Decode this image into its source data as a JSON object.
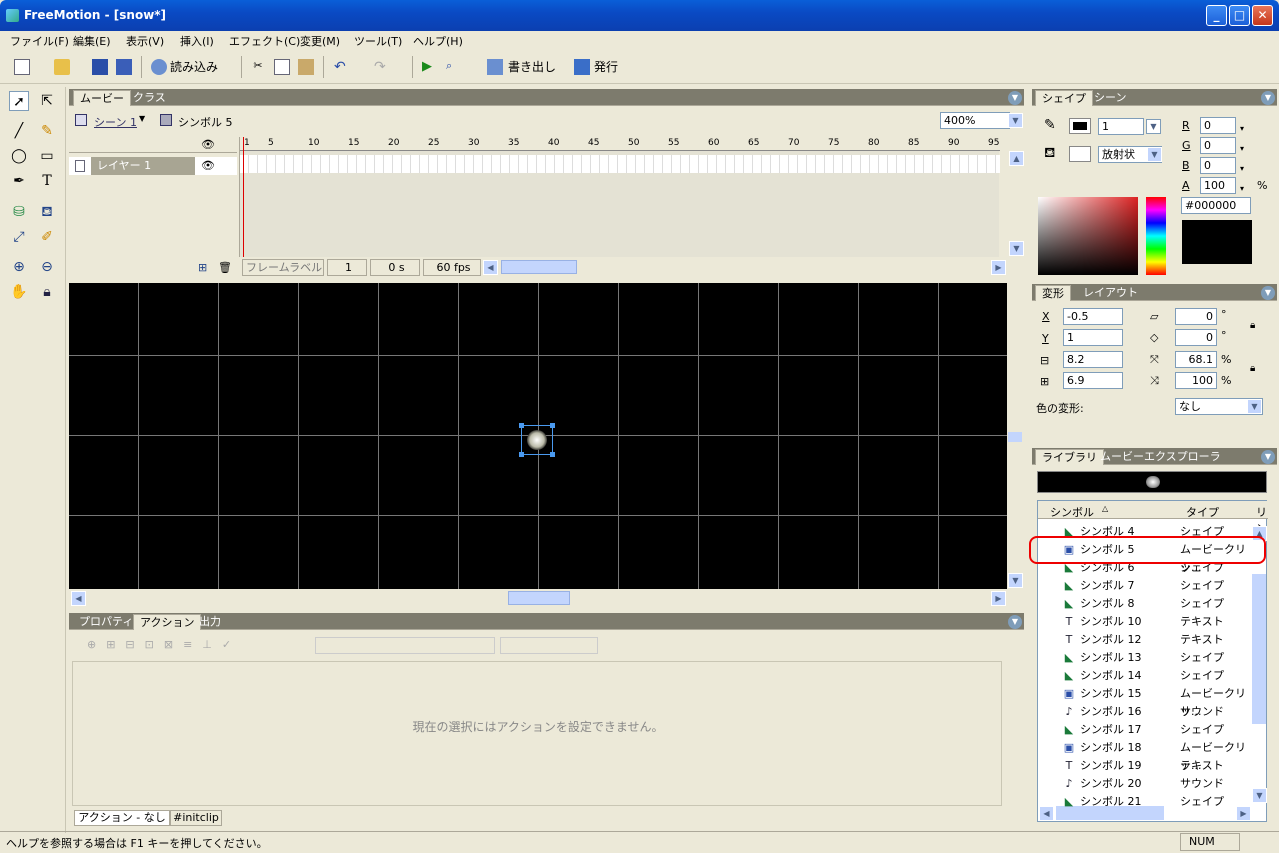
{
  "window": {
    "title": "FreeMotion - [snow*]"
  },
  "menu": [
    "ファイル(F)",
    "編集(E)",
    "表示(V)",
    "挿入(I)",
    "エフェクト(C)",
    "変更(M)",
    "ツール(T)",
    "ヘルプ(H)"
  ],
  "toolbar": {
    "import_label": "読み込み",
    "export_label": "書き出し",
    "publish_label": "発行"
  },
  "timeline": {
    "tabs": [
      "ムービー",
      "クラス"
    ],
    "scene": "シーン 1",
    "symbol": "シンボル 5",
    "zoom": "400%",
    "ruler": [
      "1",
      "5",
      "10",
      "15",
      "20",
      "25",
      "30",
      "35",
      "40",
      "45",
      "50",
      "55",
      "60",
      "65",
      "70",
      "75",
      "80",
      "85",
      "90",
      "95"
    ],
    "layer": "レイヤー 1",
    "frame_label": "フレームラベル",
    "frame": "1",
    "time": "0 s",
    "fps": "60 fps"
  },
  "bottom_panel": {
    "tabs": [
      "プロパティ",
      "アクション",
      "出力"
    ],
    "message": "現在の選択にはアクションを設定できません。",
    "subtabs": [
      "アクション - なし",
      "#initclip"
    ]
  },
  "shape_panel": {
    "tabs": [
      "シェイプ",
      "シーン"
    ],
    "stroke_width": "1",
    "fill_type": "放射状",
    "r_label": "R",
    "r": "0",
    "g_label": "G",
    "g": "0",
    "b_label": "B",
    "b": "0",
    "a_label": "A",
    "a": "100",
    "pct": "%",
    "hex": "#000000"
  },
  "transform_panel": {
    "tabs": [
      "変形",
      "レイアウト"
    ],
    "x_label": "X",
    "x": "-0.5",
    "y_label": "Y",
    "y": "1",
    "w": "8.2",
    "h": "6.9",
    "skew1": "0",
    "skew2": "0",
    "deg": "°",
    "scale_x": "68.1",
    "scale_y": "100",
    "pct": "%",
    "color_label": "色の変形:",
    "color_value": "なし"
  },
  "library": {
    "tabs": [
      "ライブラリ",
      "ムービーエクスプローラ"
    ],
    "col_symbol": "シンボル",
    "col_type": "タイプ",
    "col_link": "リン",
    "rows": [
      {
        "name": "シンボル 4",
        "type": "シェイプ",
        "icon": "shape"
      },
      {
        "name": "シンボル 5",
        "type": "ムービークリッ...",
        "icon": "movieclip"
      },
      {
        "name": "シンボル 6",
        "type": "シェイプ",
        "icon": "shape"
      },
      {
        "name": "シンボル 7",
        "type": "シェイプ",
        "icon": "shape"
      },
      {
        "name": "シンボル 8",
        "type": "シェイプ",
        "icon": "shape"
      },
      {
        "name": "シンボル 10",
        "type": "テキスト",
        "icon": "text"
      },
      {
        "name": "シンボル 12",
        "type": "テキスト",
        "icon": "text"
      },
      {
        "name": "シンボル 13",
        "type": "シェイプ",
        "icon": "shape"
      },
      {
        "name": "シンボル 14",
        "type": "シェイプ",
        "icon": "shape"
      },
      {
        "name": "シンボル 15",
        "type": "ムービークリッ...",
        "icon": "movieclip"
      },
      {
        "name": "シンボル 16",
        "type": "サウンド",
        "icon": "sound"
      },
      {
        "name": "シンボル 17",
        "type": "シェイプ",
        "icon": "shape"
      },
      {
        "name": "シンボル 18",
        "type": "ムービークリッ...",
        "icon": "movieclip"
      },
      {
        "name": "シンボル 19",
        "type": "テキスト",
        "icon": "text"
      },
      {
        "name": "シンボル 20",
        "type": "サウンド",
        "icon": "sound"
      },
      {
        "name": "シンボル 21",
        "type": "シェイプ",
        "icon": "shape"
      }
    ]
  },
  "status": {
    "help": "ヘルプを参照する場合は F1 キーを押してください。",
    "num": "NUM"
  }
}
